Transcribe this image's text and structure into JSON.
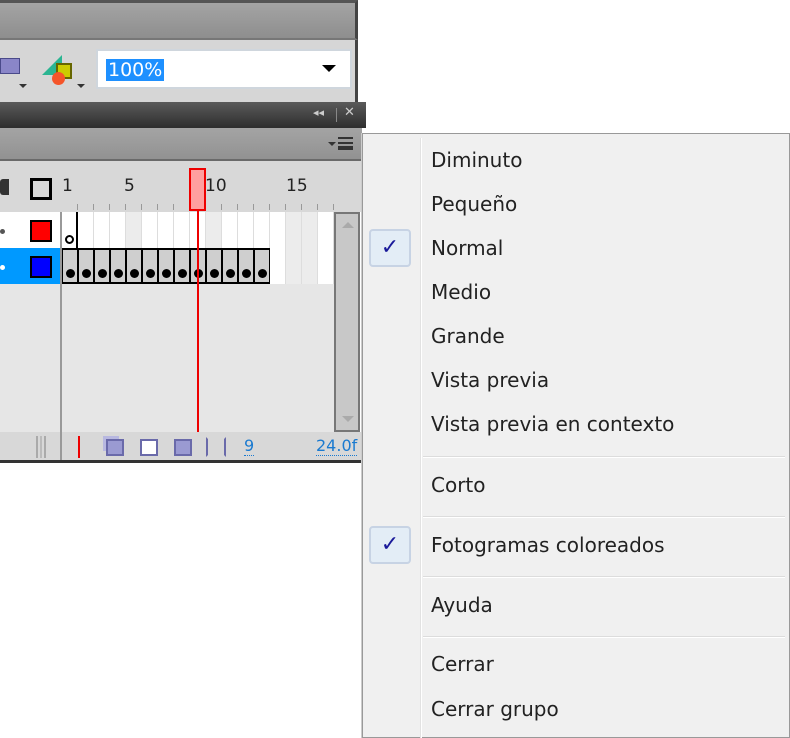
{
  "toolbar": {
    "zoom_value": "100%",
    "icons": [
      "text-icon",
      "shapes-icon"
    ]
  },
  "panel_controls": {
    "collapse": "◂◂",
    "close": "✕"
  },
  "timeline": {
    "frame_numbers": [
      "1",
      "5",
      "10",
      "15"
    ],
    "current_frame": 9,
    "layers": [
      {
        "color": "#ff0000",
        "selected": false,
        "keyframes": [
          1
        ],
        "empty_keyframe": true
      },
      {
        "color": "#0000ff",
        "selected": true,
        "keyframes": [
          1,
          2,
          3,
          4,
          5,
          6,
          7,
          8,
          9,
          10,
          11,
          12,
          13
        ],
        "empty_keyframe": false
      }
    ],
    "status": {
      "current_frame": "9",
      "fps": "24.0f"
    },
    "colors": {
      "playhead": "#ff0000",
      "selection": "#0099ff"
    }
  },
  "menu": {
    "items": [
      {
        "label": "Diminuto",
        "checked": false
      },
      {
        "label": "Pequeño",
        "checked": false
      },
      {
        "label": "Normal",
        "checked": true
      },
      {
        "label": "Medio",
        "checked": false
      },
      {
        "label": "Grande",
        "checked": false
      },
      {
        "label": "Vista previa",
        "checked": false
      },
      {
        "label": "Vista previa en contexto",
        "checked": false
      },
      {
        "label": "Corto",
        "checked": false
      },
      {
        "label": "Fotogramas coloreados",
        "checked": true
      },
      {
        "label": "Ayuda",
        "checked": false
      },
      {
        "label": "Cerrar",
        "checked": false
      },
      {
        "label": "Cerrar grupo",
        "checked": false
      }
    ],
    "check_glyph": "✓"
  }
}
